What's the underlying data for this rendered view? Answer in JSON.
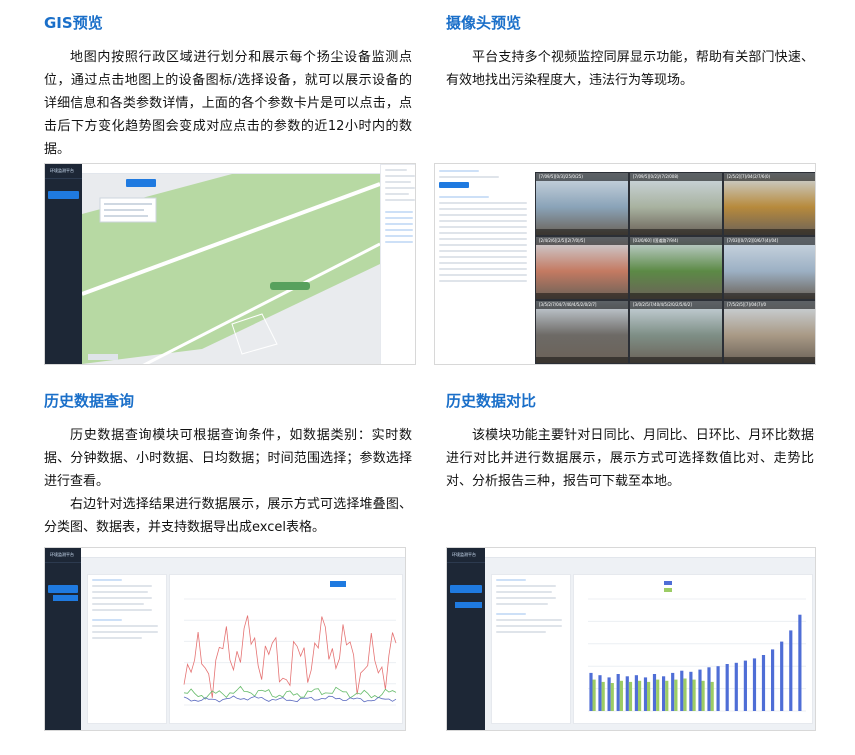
{
  "gis": {
    "title": "GIS预览",
    "text": "地图内按照行政区域进行划分和展示每个扬尘设备监测点位，通过点击地图上的设备图标/选择设备，就可以展示设备的详细信息和各类参数详情，上面的各个参数卡片是可以点击，点击后下方变化趋势图会变成对应点击的参数的近12小时内的数据。"
  },
  "camera": {
    "title": "摄像头预览",
    "text": "平台支持多个视频监控同屏显示功能，帮助有关部门快速、有效地找出污染程度大，违法行为等现场。",
    "tiles": [
      {
        "label": "[7/09/5][0/3]/25/0/25)",
        "bg": "#8aa3b8"
      },
      {
        "label": "[7/09/5][0/2]/(7/2/008)",
        "bg": "#a8b2a0"
      },
      {
        "label": "[2/5/2][7]/04(2/7/6(0)",
        "bg": "#b78a3c"
      },
      {
        "label": "[2/4/2/6][2/5][2(7/0)/5]",
        "bg": "#c47a62"
      },
      {
        "label": "[03/0/60] (国道路7/9/4)",
        "bg": "#5c8a46"
      },
      {
        "label": "[7/03][0/7/2][0/6/7(4)/04]",
        "bg": "#9cb0c4"
      },
      {
        "label": "[3/5/2/7/04/7/40/4/5/2/0/2/7]",
        "bg": "#6d6a66"
      },
      {
        "label": "[3/0/2/5/7/40/4/5/2/0/2/5/0/2]",
        "bg": "#7e8f86"
      },
      {
        "label": "[7/5/2/5][7]/04(7)/0",
        "bg": "#a99a86"
      }
    ]
  },
  "history_query": {
    "title": "历史数据查询",
    "text1": "历史数据查询模块可根据查询条件，如数据类别：实时数据、分钟数据、小时数据、日均数据；时间范围选择；参数选择进行查看。",
    "text2": "右边针对选择结果进行数据展示，展示方式可选择堆叠图、分类图、数据表，并支持数据导出成excel表格。"
  },
  "history_compare": {
    "title": "历史数据对比",
    "text": "该模块功能主要针对日同比、月同比、日环比、月环比数据进行对比并进行数据展示，展示方式可选择数值比对、走势比对、分析报告三种，报告可下载至本地。",
    "bars_blue": [
      0.34,
      0.32,
      0.3,
      0.33,
      0.31,
      0.32,
      0.3,
      0.33,
      0.31,
      0.34,
      0.36,
      0.35,
      0.37,
      0.39,
      0.4,
      0.42,
      0.43,
      0.45,
      0.47,
      0.5,
      0.55,
      0.62,
      0.72,
      0.86
    ],
    "bars_green": [
      0.28,
      0.26,
      0.25,
      0.27,
      0.26,
      0.27,
      0.26,
      0.28,
      0.27,
      0.28,
      0.29,
      0.28,
      0.27,
      0.26
    ]
  }
}
